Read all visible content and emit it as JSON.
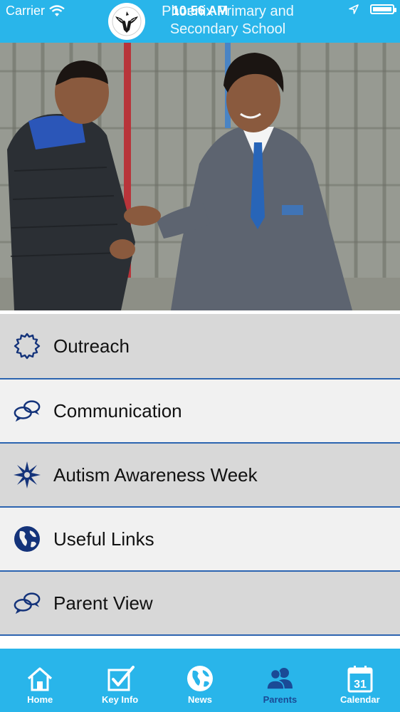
{
  "status_bar": {
    "carrier": "Carrier",
    "time": "10:56 AM"
  },
  "header": {
    "title_line1": "Phoenix Primary and",
    "title_line2": "Secondary School"
  },
  "menu": {
    "items": [
      {
        "label": "Outreach",
        "icon": "badge-icon"
      },
      {
        "label": "Communication",
        "icon": "speech-bubbles-icon"
      },
      {
        "label": "Autism Awareness Week",
        "icon": "starburst-icon"
      },
      {
        "label": "Useful Links",
        "icon": "globe-icon"
      },
      {
        "label": "Parent View",
        "icon": "speech-bubbles-icon"
      }
    ]
  },
  "tabbar": {
    "tabs": [
      {
        "label": "Home",
        "icon": "house-icon"
      },
      {
        "label": "Key Info",
        "icon": "checkbox-icon"
      },
      {
        "label": "News",
        "icon": "globe-icon"
      },
      {
        "label": "Parents",
        "icon": "people-icon"
      },
      {
        "label": "Calendar",
        "icon": "calendar-icon",
        "day": "31"
      }
    ],
    "active": "Parents"
  },
  "colors": {
    "header_bg": "#29b5ea",
    "accent": "#1a4a96",
    "divider": "#2c64b0"
  }
}
